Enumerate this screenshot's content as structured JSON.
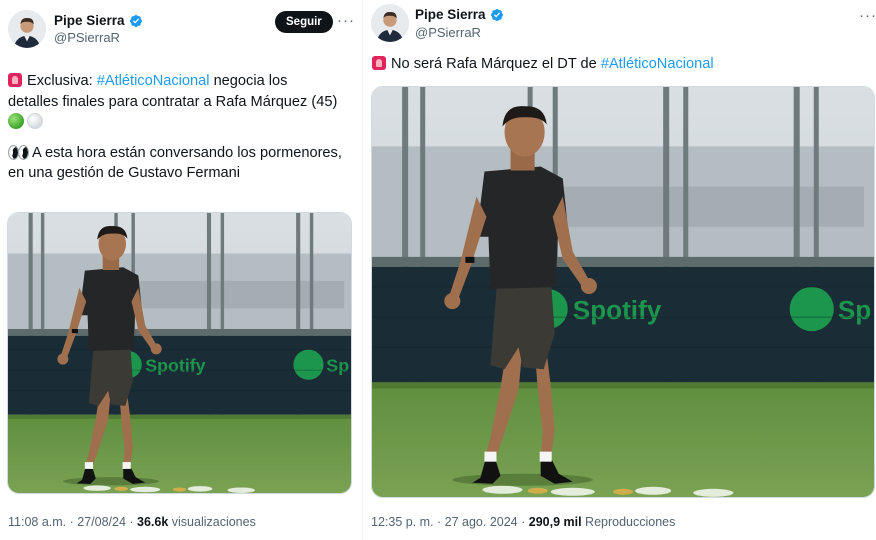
{
  "left": {
    "author": {
      "name": "Pipe Sierra",
      "handle": "@PSierraR"
    },
    "follow_label": "Seguir",
    "more_label": "···",
    "text": {
      "line1_prefix": "Exclusiva: ",
      "hashtag": "#AtléticoNacional",
      "line1_suffix": " negocia los",
      "line2": "detalles finales para contratar a Rafa Márquez (45)",
      "line4": "A esta hora están conversando los pormenores,",
      "line5": "en una gestión de Gustavo Fermani"
    },
    "media": {
      "sponsor": "Spotify"
    },
    "meta": {
      "time": "11:08 a.m. · 27/08/24 · ",
      "views_count": "36.6k",
      "views_label": " visualizaciones"
    }
  },
  "right": {
    "author": {
      "name": "Pipe Sierra",
      "handle": "@PSierraR"
    },
    "more_label": "···",
    "text": {
      "prefix": "No será Rafa Márquez el DT de ",
      "hashtag": "#AtléticoNacional"
    },
    "media": {
      "sponsor": "Spotify"
    },
    "meta": {
      "time": "12:35 p. m. · 27 ago. 2024 · ",
      "views_count": "290,9 mil",
      "views_label": " Reproducciones"
    }
  },
  "colors": {
    "accent": "#1d9bf0",
    "text": "#0f1419",
    "muted": "#536471",
    "spotify": "#1db954"
  },
  "icons": [
    "verified-badge-icon",
    "siren-emoji-icon",
    "green-circle-emoji-icon",
    "white-circle-emoji-icon",
    "eyes-emoji-icon",
    "more-dots-icon"
  ]
}
